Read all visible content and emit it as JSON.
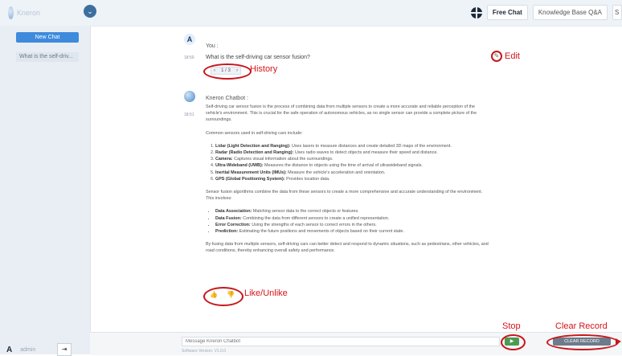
{
  "header": {
    "logo_text": "Kneron",
    "tabs": [
      "Free Chat",
      "Knowledge Base Q&A",
      "S"
    ],
    "active_tab": "Free Chat"
  },
  "sidebar": {
    "new_chat_label": "New Chat",
    "collapse_icon": "chevron-icon",
    "history": [
      "What is the self-driv..."
    ],
    "user_initial": "A",
    "user_name": "admin",
    "logout_icon": "logout-icon"
  },
  "conversation": {
    "user": {
      "initial": "A",
      "sender": "You :",
      "time": "18:50",
      "question": "What is the self-driving car sensor fusion?",
      "pager": {
        "prev": "‹",
        "text": "1 / 3",
        "next": "›"
      }
    },
    "bot": {
      "sender": "Kneron Chatbot :",
      "time": "18:51",
      "intro": "Self-driving car sensor fusion is the process of combining data from multiple sensors to create a more accurate and reliable perception of the vehicle's environment. This is crucial for the safe operation of autonomous vehicles, as no single sensor can provide a complete picture of the surroundings.",
      "sensors_intro": "Common sensors used in self-driving cars include:",
      "sensors": [
        {
          "name": "Lidar (Light Detection and Ranging):",
          "desc": "Uses lasers to measure distances and create detailed 3D maps of the environment."
        },
        {
          "name": "Radar (Radio Detection and Ranging):",
          "desc": "Uses radio waves to detect objects and measure their speed and distance."
        },
        {
          "name": "Camera:",
          "desc": "Captures visual information about the surroundings."
        },
        {
          "name": "Ultra-Wideband (UWB):",
          "desc": "Measures the distance to objects using the time of arrival of ultrawideband signals."
        },
        {
          "name": "Inertial Measurement Units (IMUs):",
          "desc": "Measure the vehicle's acceleration and orientation."
        },
        {
          "name": "GPS (Global Positioning System):",
          "desc": "Provides location data."
        }
      ],
      "fusion_intro": "Sensor fusion algorithms combine the data from these sensors to create a more comprehensive and accurate understanding of the environment. This involves:",
      "steps": [
        {
          "name": "Data Association:",
          "desc": "Matching sensor data to the correct objects or features."
        },
        {
          "name": "Data Fusion:",
          "desc": "Combining the data from different sensors to create a unified representation."
        },
        {
          "name": "Error Correction:",
          "desc": "Using the strengths of each sensor to correct errors in the others."
        },
        {
          "name": "Prediction:",
          "desc": "Estimating the future positions and movements of objects based on their current state."
        }
      ],
      "conclusion": "By fusing data from multiple sensors, self-driving cars can better detect and respond to dynamic situations, such as pedestrians, other vehicles, and road conditions, thereby enhancing overall safety and performance."
    }
  },
  "annotations": {
    "history": "History",
    "edit": "Edit",
    "like": "Like/Unlike",
    "stop": "Stop",
    "clear": "Clear Record"
  },
  "input": {
    "placeholder": "Message Kneron Chatbot",
    "version": "Software Version: V1.0.0",
    "send_icon": "play-icon",
    "clear_label": "CLEAR RECORD"
  },
  "colors": {
    "accent": "#3e8bdc",
    "annotation_red": "#c8151b",
    "send_green": "#4c9b54"
  }
}
